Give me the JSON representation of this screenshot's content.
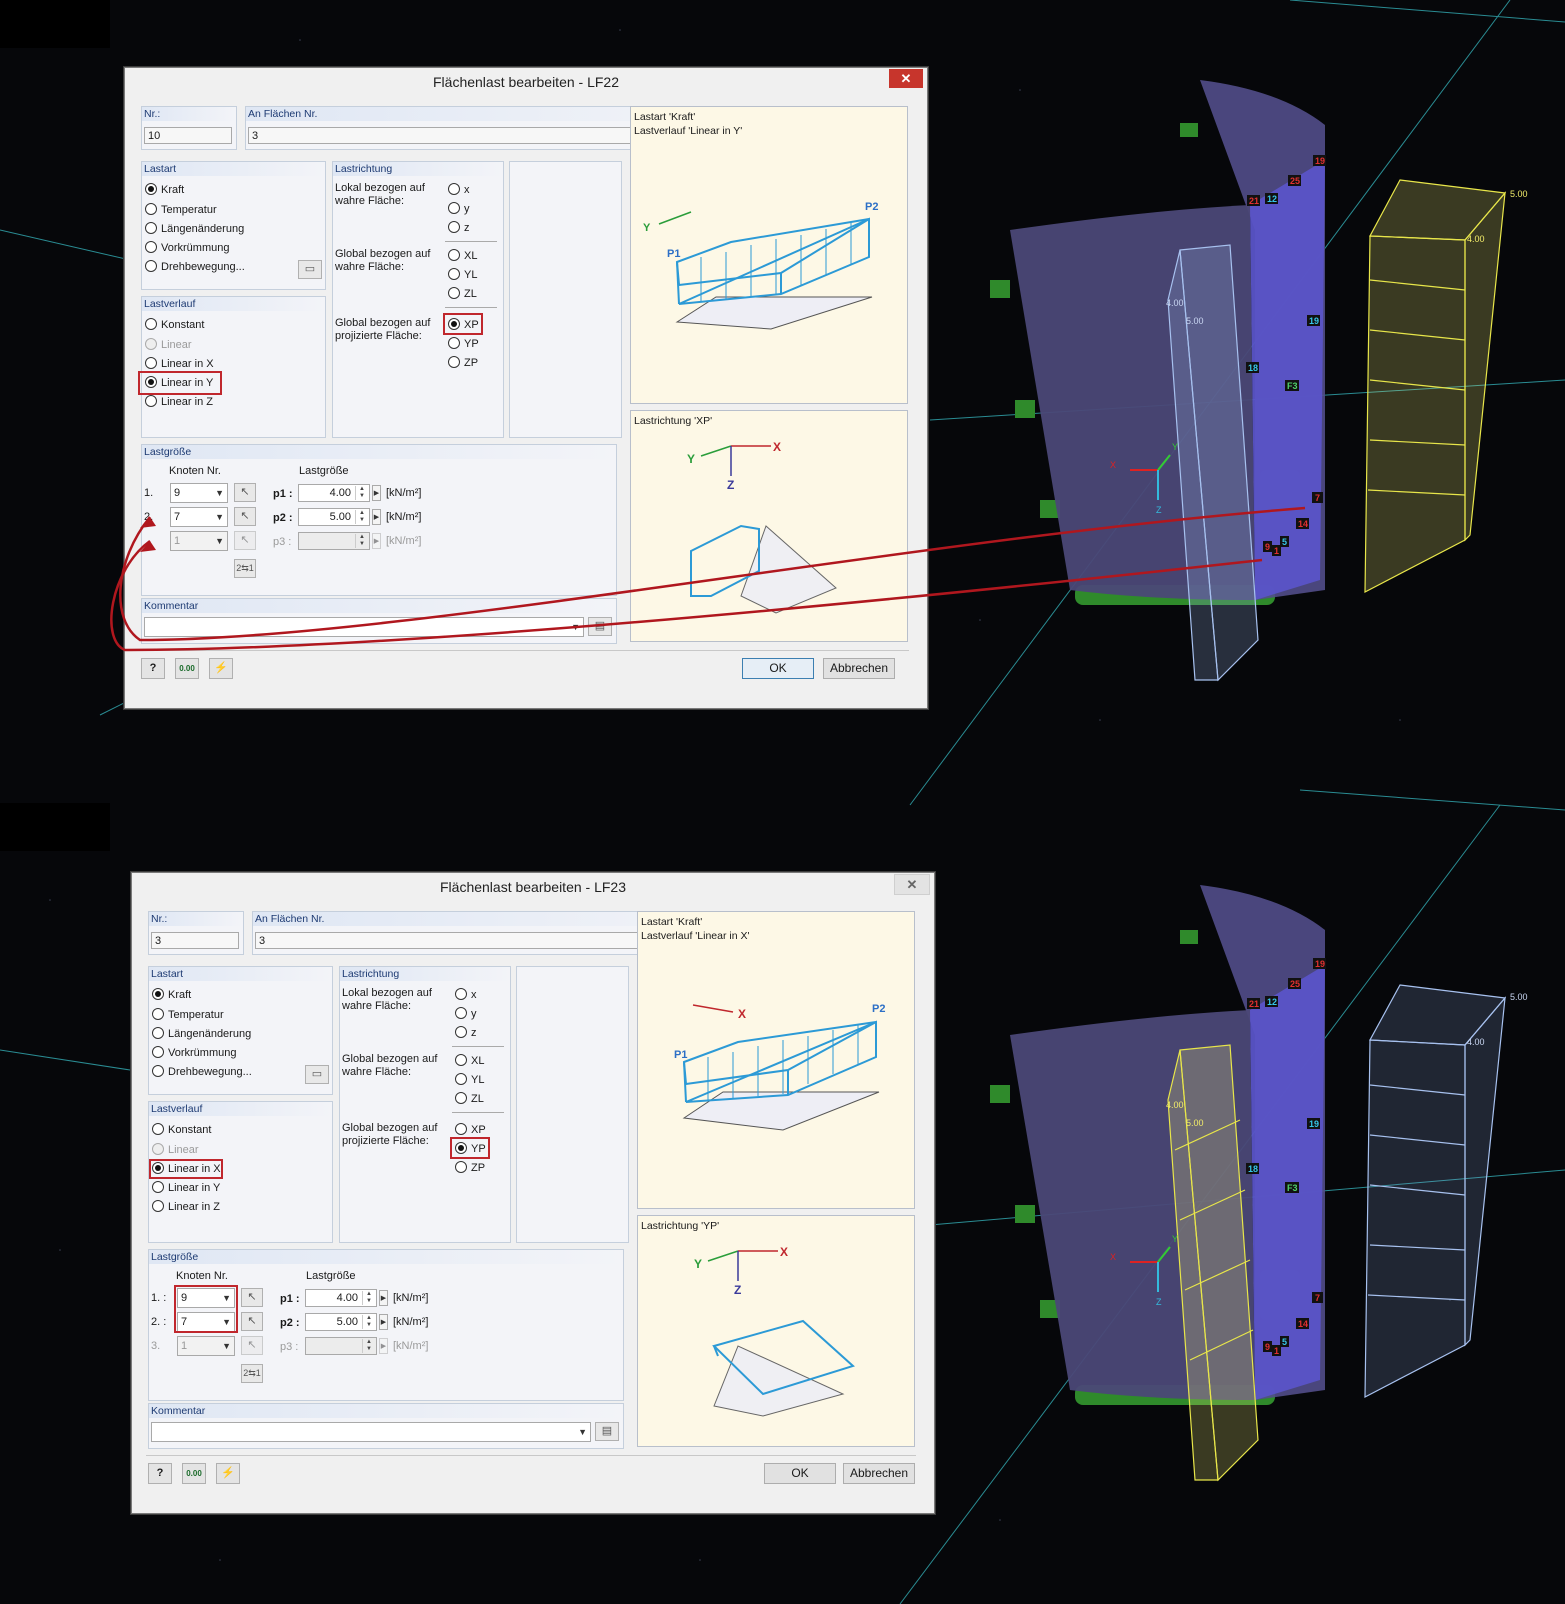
{
  "dialog1": {
    "title": "Flächenlast bearbeiten - LF22",
    "close": "✕",
    "nr_label": "Nr.:",
    "nr_value": "10",
    "surfaces_label": "An Flächen Nr.",
    "surfaces_value": "3",
    "lastart_title": "Lastart",
    "lastart_options": [
      "Kraft",
      "Temperatur",
      "Längenänderung",
      "Vorkrümmung",
      "Drehbewegung..."
    ],
    "lastverlauf_title": "Lastverlauf",
    "lastverlauf_options": [
      "Konstant",
      "Linear",
      "Linear in X",
      "Linear in Y",
      "Linear in Z"
    ],
    "lastrichtung_title": "Lastrichtung",
    "lokal_label": "Lokal bezogen auf wahre Fläche:",
    "lokal_options": [
      "x",
      "y",
      "z"
    ],
    "global_label": "Global bezogen auf wahre Fläche:",
    "global_options": [
      "XL",
      "YL",
      "ZL"
    ],
    "proj_label": "Global bezogen auf projizierte Fläche:",
    "proj_options": [
      "XP",
      "YP",
      "ZP"
    ],
    "lastgroesse_title": "Lastgröße",
    "knoten_header": "Knoten Nr.",
    "value_header": "Lastgröße",
    "rows": [
      {
        "idx": "1.",
        "node": "9",
        "p": "p1 :",
        "value": "4.00",
        "unit": "[kN/m²]"
      },
      {
        "idx": "2.",
        "node": "7",
        "p": "p2 :",
        "value": "5.00",
        "unit": "[kN/m²]"
      },
      {
        "idx": "3.",
        "node": "1",
        "p": "p3 :",
        "value": "",
        "unit": "[kN/m²]"
      }
    ],
    "swap_icon": "2⇆1",
    "kommentar_title": "Kommentar",
    "preview_top": "Lastart 'Kraft'\nLastverlauf 'Linear in Y'",
    "preview_bottom": "Lastrichtung 'XP'",
    "ok": "OK",
    "cancel": "Abbrechen",
    "icon_help": "?",
    "icon_value": "0.00"
  },
  "dialog2": {
    "title": "Flächenlast bearbeiten - LF23",
    "close": "✕",
    "nr_label": "Nr.:",
    "nr_value": "3",
    "surfaces_label": "An Flächen Nr.",
    "surfaces_value": "3",
    "lastart_title": "Lastart",
    "lastart_options": [
      "Kraft",
      "Temperatur",
      "Längenänderung",
      "Vorkrümmung",
      "Drehbewegung..."
    ],
    "lastverlauf_title": "Lastverlauf",
    "lastverlauf_options": [
      "Konstant",
      "Linear",
      "Linear in X",
      "Linear in Y",
      "Linear in Z"
    ],
    "lastrichtung_title": "Lastrichtung",
    "lokal_label": "Lokal bezogen auf wahre Fläche:",
    "lokal_options": [
      "x",
      "y",
      "z"
    ],
    "global_label": "Global bezogen auf wahre Fläche:",
    "global_options": [
      "XL",
      "YL",
      "ZL"
    ],
    "proj_label": "Global bezogen auf projizierte Fläche:",
    "proj_options": [
      "XP",
      "YP",
      "ZP"
    ],
    "lastgroesse_title": "Lastgröße",
    "knoten_header": "Knoten Nr.",
    "value_header": "Lastgröße",
    "rows": [
      {
        "idx": "1. :",
        "node": "9",
        "p": "p1 :",
        "value": "4.00",
        "unit": "[kN/m²]"
      },
      {
        "idx": "2. :",
        "node": "7",
        "p": "p2 :",
        "value": "5.00",
        "unit": "[kN/m²]"
      },
      {
        "idx": "3.",
        "node": "1",
        "p": "p3 :",
        "value": "",
        "unit": "[kN/m²]"
      }
    ],
    "swap_icon": "2⇆1",
    "kommentar_title": "Kommentar",
    "preview_top": "Lastart 'Kraft'\nLastverlauf 'Linear in X'",
    "preview_bottom": "Lastrichtung 'YP'",
    "ok": "OK",
    "cancel": "Abbrechen",
    "icon_help": "?",
    "icon_value": "0.00"
  },
  "scene_top": {
    "node_labels": [
      "19",
      "25",
      "21",
      "12",
      "19",
      "18",
      "F3",
      "7",
      "14",
      "9",
      "1",
      "5"
    ],
    "load_values": [
      "5.00",
      "4.00",
      "4.00",
      "5.00"
    ],
    "axes": [
      "X",
      "Y",
      "Z"
    ]
  },
  "scene_bottom": {
    "node_labels": [
      "19",
      "25",
      "21",
      "12",
      "19",
      "18",
      "F3",
      "7",
      "14",
      "9",
      "1",
      "5"
    ],
    "load_values": [
      "5.00",
      "4.00",
      "4.00",
      "5.00"
    ],
    "axes": [
      "X",
      "Y",
      "Z"
    ]
  },
  "preview_axes": {
    "x": "X",
    "y": "Y",
    "z": "Z",
    "p1": "P1",
    "p2": "P2"
  },
  "colors": {
    "highlight": "#c0272d",
    "load_blue": "#2c9ad6",
    "load_yellow": "#e8e64a",
    "surface": "#7b78c4"
  }
}
